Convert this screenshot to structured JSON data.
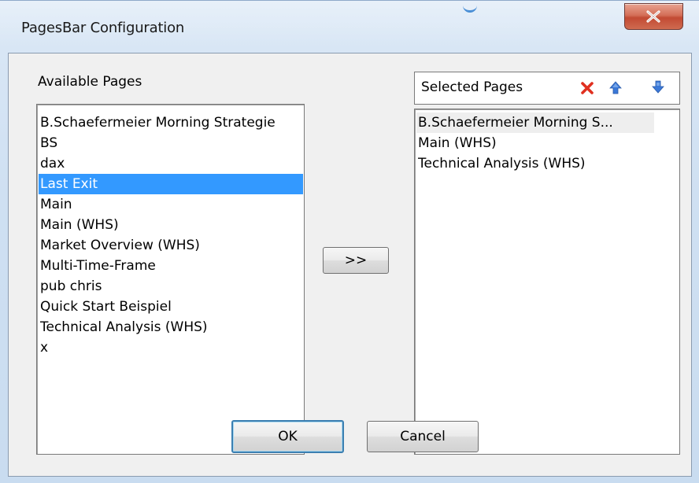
{
  "window": {
    "title": "PagesBar Configuration"
  },
  "available": {
    "label": "Available Pages",
    "items": [
      "B.Schaefermeier Morning Strategie",
      "BS",
      "dax",
      "Last Exit",
      "Main",
      "Main (WHS)",
      "Market Overview (WHS)",
      "Multi-Time-Frame",
      "pub chris",
      "Quick Start Beispiel",
      "Technical Analysis (WHS)",
      "x"
    ],
    "selected": "Last Exit"
  },
  "selected_pages": {
    "label": "Selected Pages",
    "items": [
      "B.Schaefermeier Morning S...",
      "Main (WHS)",
      "Technical Analysis (WHS)"
    ],
    "icons": [
      "delete-icon",
      "move-up-icon",
      "move-down-icon"
    ]
  },
  "buttons": {
    "add": ">>",
    "ok": "OK",
    "cancel": "Cancel"
  },
  "colors": {
    "selection": "#3399ff",
    "delete": "#e03020",
    "arrow": "#3a78d8"
  }
}
